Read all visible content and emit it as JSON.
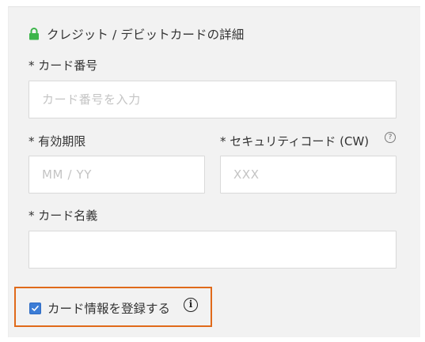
{
  "section": {
    "title": "クレジット / デビットカードの詳細",
    "lock_color": "#3cb54a"
  },
  "card_number": {
    "label": "* カード番号",
    "placeholder": "カード番号を入力",
    "value": ""
  },
  "expiry": {
    "label": "* 有効期限",
    "placeholder": "MM / YY",
    "value": ""
  },
  "security_code": {
    "label": "* セキュリティコード (CW)",
    "placeholder": "XXX",
    "value": "",
    "help_icon": "question-icon",
    "help_glyph": "?"
  },
  "card_name": {
    "label": "* カード名義",
    "placeholder": "",
    "value": ""
  },
  "save_card": {
    "label": "カード情報を登録する",
    "checked": true,
    "info_glyph": "i",
    "highlight_color": "#e06a1a",
    "checkbox_color": "#3d7dd6"
  }
}
